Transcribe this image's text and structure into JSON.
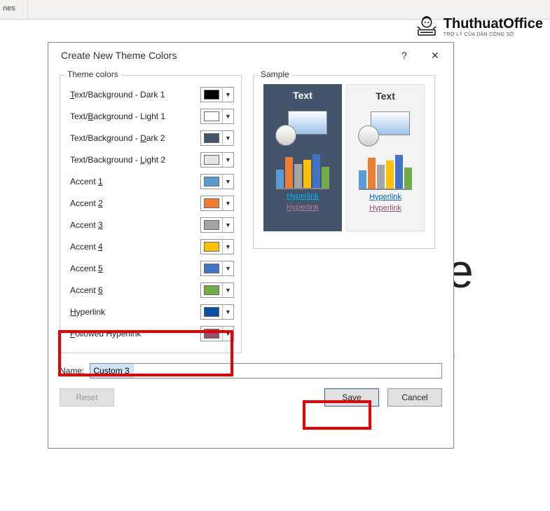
{
  "ribbon_fragment": "nes",
  "background": {
    "big_text_fragment": "fice",
    "link_fragment": "oint"
  },
  "watermark": {
    "brand": "ThuthuatOffice",
    "tagline": "TRỢ LÝ CỦA DÂN CÔNG SỞ"
  },
  "dialog": {
    "title": "Create New Theme Colors",
    "help_symbol": "?",
    "close_symbol": "✕",
    "group_theme": "Theme colors",
    "group_sample": "Sample",
    "rows": [
      {
        "label_pre": "",
        "label_u": "T",
        "label_post": "ext/Background - Dark 1",
        "color": "#000000"
      },
      {
        "label_pre": "Text/",
        "label_u": "B",
        "label_post": "ackground - Light 1",
        "color": "#ffffff"
      },
      {
        "label_pre": "Text/Background - ",
        "label_u": "D",
        "label_post": "ark 2",
        "color": "#44546a"
      },
      {
        "label_pre": "Text/Background - ",
        "label_u": "L",
        "label_post": "ight 2",
        "color": "#e7e6e6"
      },
      {
        "label_pre": "Accent ",
        "label_u": "1",
        "label_post": "",
        "color": "#5b9bd5"
      },
      {
        "label_pre": "Accent ",
        "label_u": "2",
        "label_post": "",
        "color": "#ed7d31"
      },
      {
        "label_pre": "Accent ",
        "label_u": "3",
        "label_post": "",
        "color": "#a5a5a5"
      },
      {
        "label_pre": "Accent ",
        "label_u": "4",
        "label_post": "",
        "color": "#ffc000"
      },
      {
        "label_pre": "Accent ",
        "label_u": "5",
        "label_post": "",
        "color": "#4472c4"
      },
      {
        "label_pre": "Accent ",
        "label_u": "6",
        "label_post": "",
        "color": "#70ad47"
      },
      {
        "label_pre": "",
        "label_u": "H",
        "label_post": "yperlink",
        "color": "#0b4fa4"
      },
      {
        "label_pre": "",
        "label_u": "F",
        "label_post": "ollowed Hyperlink",
        "color": "#954f72"
      }
    ],
    "sample_card": {
      "title": "Text",
      "bars": [
        "#5b9bd5",
        "#ed7d31",
        "#a5a5a5",
        "#ffc000",
        "#4472c4",
        "#70ad47"
      ],
      "hyperlink_label": "Hyperlink",
      "dark_link_color": "#00b0f0",
      "dark_followed_color": "#b77b97",
      "light_link_color": "#0563c1",
      "light_followed_color": "#954f72"
    },
    "name_label_u": "N",
    "name_label_post": "ame:",
    "name_value": "Custom 3",
    "reset_u": "R",
    "reset_post": "eset",
    "save_u": "S",
    "save_post": "ave",
    "cancel": "Cancel"
  }
}
